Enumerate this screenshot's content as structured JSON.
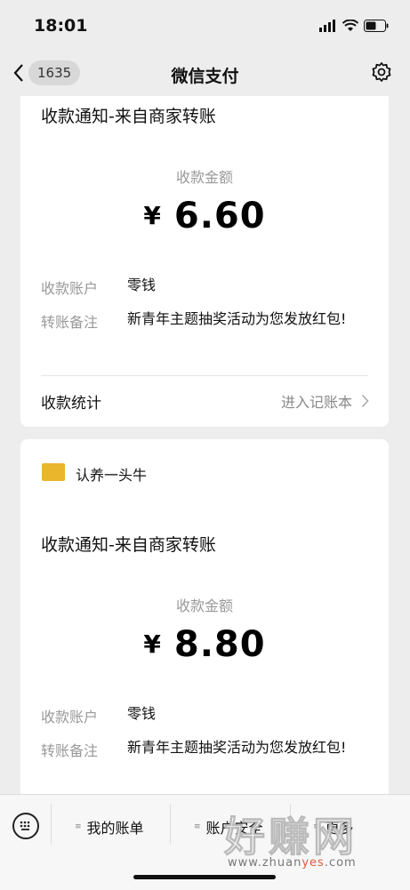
{
  "status": {
    "time": "18:01"
  },
  "nav": {
    "back_count": "1635",
    "title": "微信支付"
  },
  "cards": [
    {
      "title": "收款通知-来自商家转账",
      "amount_label": "收款金额",
      "currency": "¥",
      "amount": "6.60",
      "account_label": "收款账户",
      "account_value": "零钱",
      "note_label": "转账备注",
      "note_value": "新青年主题抽奖活动为您发放红包!",
      "stats_label": "收款统计",
      "stats_link": "进入记账本"
    },
    {
      "merchant": "认养一头牛",
      "title": "收款通知-来自商家转账",
      "amount_label": "收款金额",
      "currency": "¥",
      "amount": "8.80",
      "account_label": "收款账户",
      "account_value": "零钱",
      "note_label": "转账备注",
      "note_value": "新青年主题抽奖活动为您发放红包!"
    }
  ],
  "toolbar": {
    "items": [
      "我的账单",
      "账户安全",
      "更多"
    ]
  },
  "watermark": {
    "big": "好赚网",
    "small_pre": "www.zhuan",
    "small_hl": "yes",
    "small_post": ".com"
  }
}
